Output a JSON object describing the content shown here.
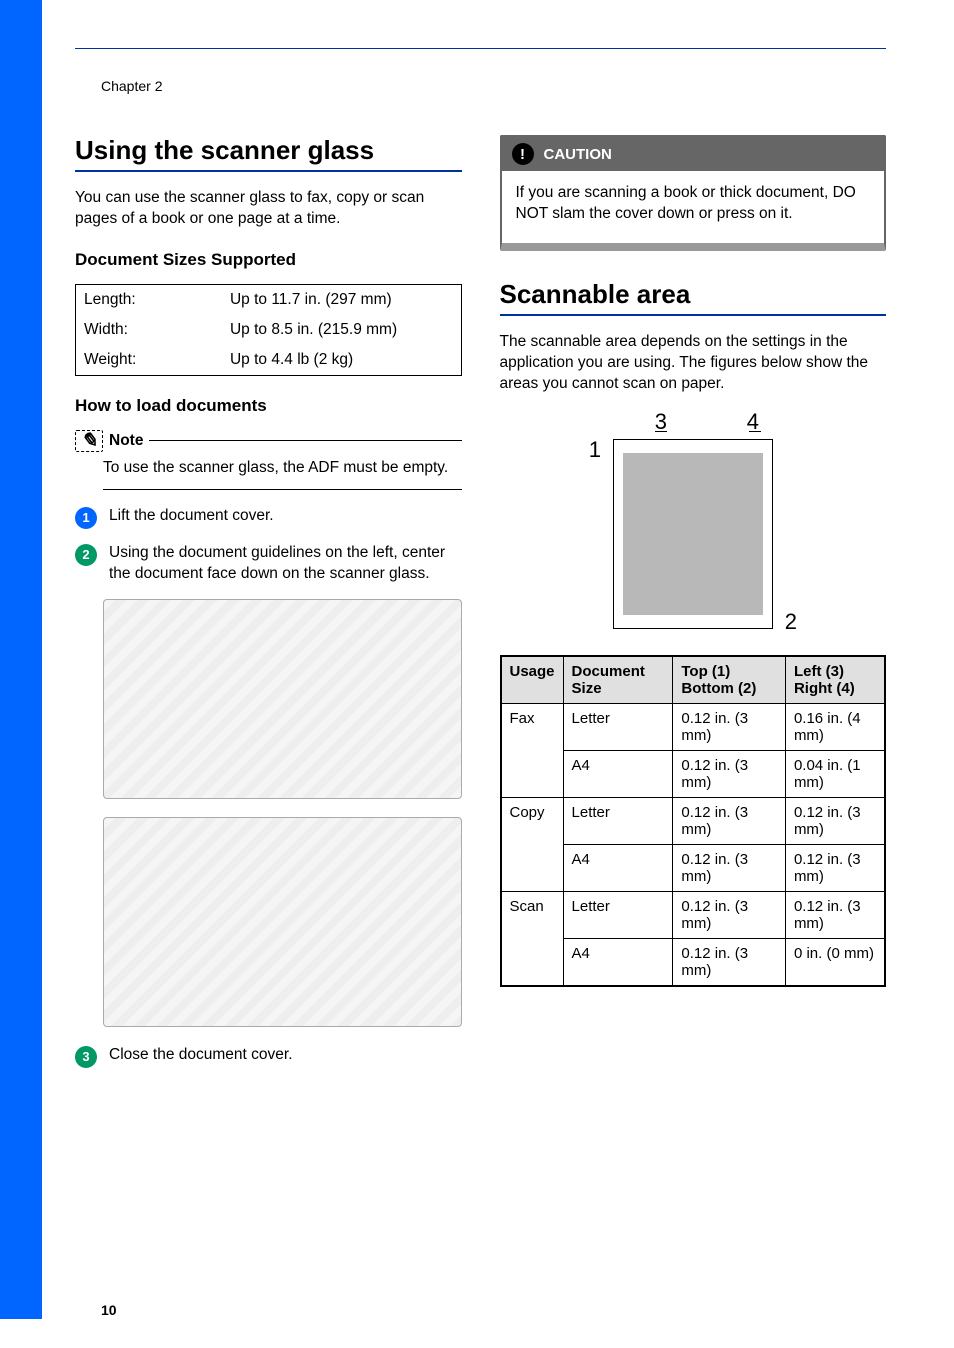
{
  "chapter": "Chapter 2",
  "page_number": "10",
  "left": {
    "h1": "Using the scanner glass",
    "intro": "You can use the scanner glass to fax, copy or scan pages of a book or one page at a time.",
    "specs_heading": "Document Sizes Supported",
    "specs": [
      {
        "label": "Length:",
        "value": "Up to 11.7 in. (297 mm)"
      },
      {
        "label": "Width:",
        "value": "Up to 8.5 in. (215.9 mm)"
      },
      {
        "label": "Weight:",
        "value": "Up to 4.4 lb (2 kg)"
      }
    ],
    "howto_heading": "How to load documents",
    "note_label": "Note",
    "note_text": "To use the scanner glass, the ADF must be empty.",
    "steps": {
      "s1": "Lift the document cover.",
      "s2": "Using the document guidelines on the left, center the document face down on the scanner glass.",
      "s3": "Close the document cover."
    }
  },
  "right": {
    "caution_label": "CAUTION",
    "caution_text": "If you are scanning a book or thick document, DO NOT slam the cover down or press on it.",
    "h1": "Scannable area",
    "intro": "The scannable area depends on the settings in the application you are using. The figures below show the areas you cannot scan on paper.",
    "diagram_labels": {
      "l1": "1",
      "l2": "2",
      "l3": "3",
      "l4": "4"
    },
    "headers": {
      "usage": "Usage",
      "docsize": "Document Size",
      "topbottom": "Top (1) Bottom (2)",
      "leftright": "Left (3) Right (4)"
    },
    "rows": {
      "fax_label": "Fax",
      "copy_label": "Copy",
      "scan_label": "Scan",
      "letter": "Letter",
      "a4": "A4",
      "v_012_3": "0.12 in. (3 mm)",
      "v_016_4": "0.16 in. (4 mm)",
      "v_004_1": "0.04 in. (1 mm)",
      "v_0_0": "0 in. (0 mm)"
    }
  }
}
